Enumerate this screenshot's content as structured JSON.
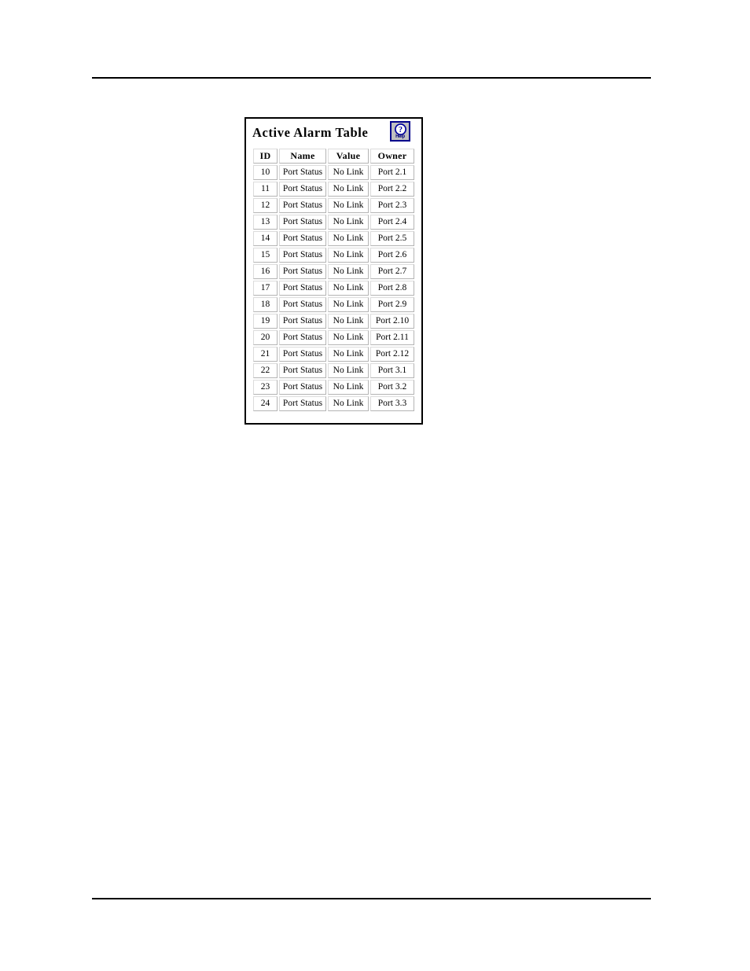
{
  "page": {
    "background": "#ffffff",
    "rule_color": "#000000"
  },
  "panel": {
    "title": "Active Alarm Table",
    "border_color": "#000000",
    "help_button": {
      "label": "Help",
      "icon": "question-mark-circle-icon",
      "border_color": "#00008b",
      "face_color": "#c0c0c0",
      "glyph_color": "#0000a8"
    }
  },
  "table": {
    "columns": [
      "ID",
      "Name",
      "Value",
      "Owner"
    ],
    "rows": [
      {
        "id": "10",
        "name": "Port Status",
        "value": "No Link",
        "owner": "Port 2.1"
      },
      {
        "id": "11",
        "name": "Port Status",
        "value": "No Link",
        "owner": "Port 2.2"
      },
      {
        "id": "12",
        "name": "Port Status",
        "value": "No Link",
        "owner": "Port 2.3"
      },
      {
        "id": "13",
        "name": "Port Status",
        "value": "No Link",
        "owner": "Port 2.4"
      },
      {
        "id": "14",
        "name": "Port Status",
        "value": "No Link",
        "owner": "Port 2.5"
      },
      {
        "id": "15",
        "name": "Port Status",
        "value": "No Link",
        "owner": "Port 2.6"
      },
      {
        "id": "16",
        "name": "Port Status",
        "value": "No Link",
        "owner": "Port 2.7"
      },
      {
        "id": "17",
        "name": "Port Status",
        "value": "No Link",
        "owner": "Port 2.8"
      },
      {
        "id": "18",
        "name": "Port Status",
        "value": "No Link",
        "owner": "Port 2.9"
      },
      {
        "id": "19",
        "name": "Port Status",
        "value": "No Link",
        "owner": "Port 2.10"
      },
      {
        "id": "20",
        "name": "Port Status",
        "value": "No Link",
        "owner": "Port 2.11"
      },
      {
        "id": "21",
        "name": "Port Status",
        "value": "No Link",
        "owner": "Port 2.12"
      },
      {
        "id": "22",
        "name": "Port Status",
        "value": "No Link",
        "owner": "Port 3.1"
      },
      {
        "id": "23",
        "name": "Port Status",
        "value": "No Link",
        "owner": "Port 3.2"
      },
      {
        "id": "24",
        "name": "Port Status",
        "value": "No Link",
        "owner": "Port 3.3"
      }
    ]
  }
}
